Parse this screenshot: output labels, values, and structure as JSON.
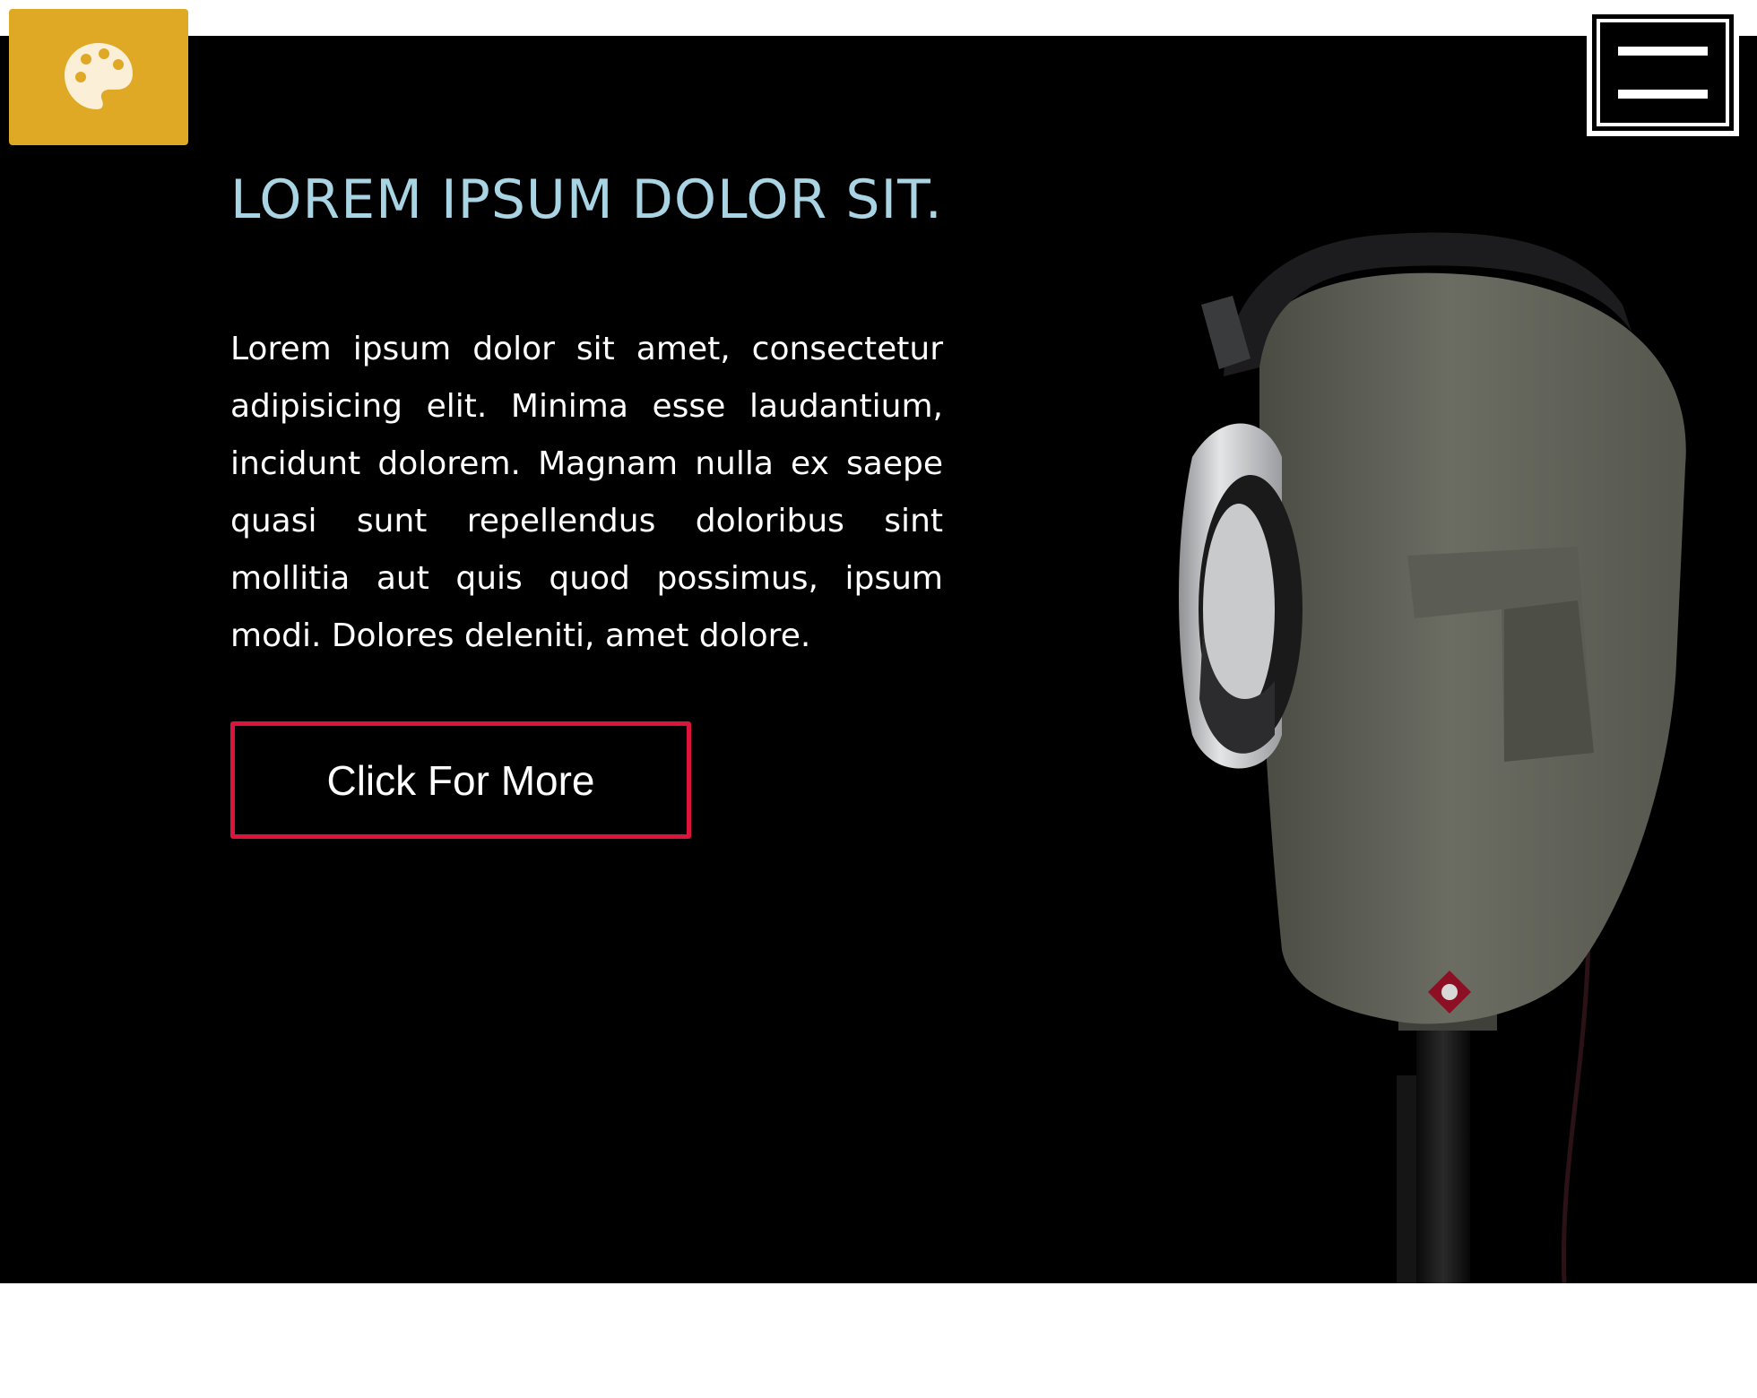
{
  "header": {
    "logo_icon": "palette-icon",
    "menu_icon": "hamburger-menu-icon"
  },
  "hero": {
    "title": "LOREM IPSUM DOLOR SIT.",
    "text": "Lorem ipsum dolor sit amet, consectetur adipisicing elit. Minima esse laudantium, incidunt dolorem. Magnam nulla ex saepe quasi sunt repellendus doloribus sint mollitia aut quis quod possimus, ipsum modi. Dolores deleniti, amet dolore.",
    "cta_label": "Click For More",
    "image": "mannequin-head-with-headphones"
  },
  "colors": {
    "logo_bg": "#dfa825",
    "title": "#a9d4e4",
    "cta_border": "#dc143c",
    "hero_bg": "#000000"
  }
}
